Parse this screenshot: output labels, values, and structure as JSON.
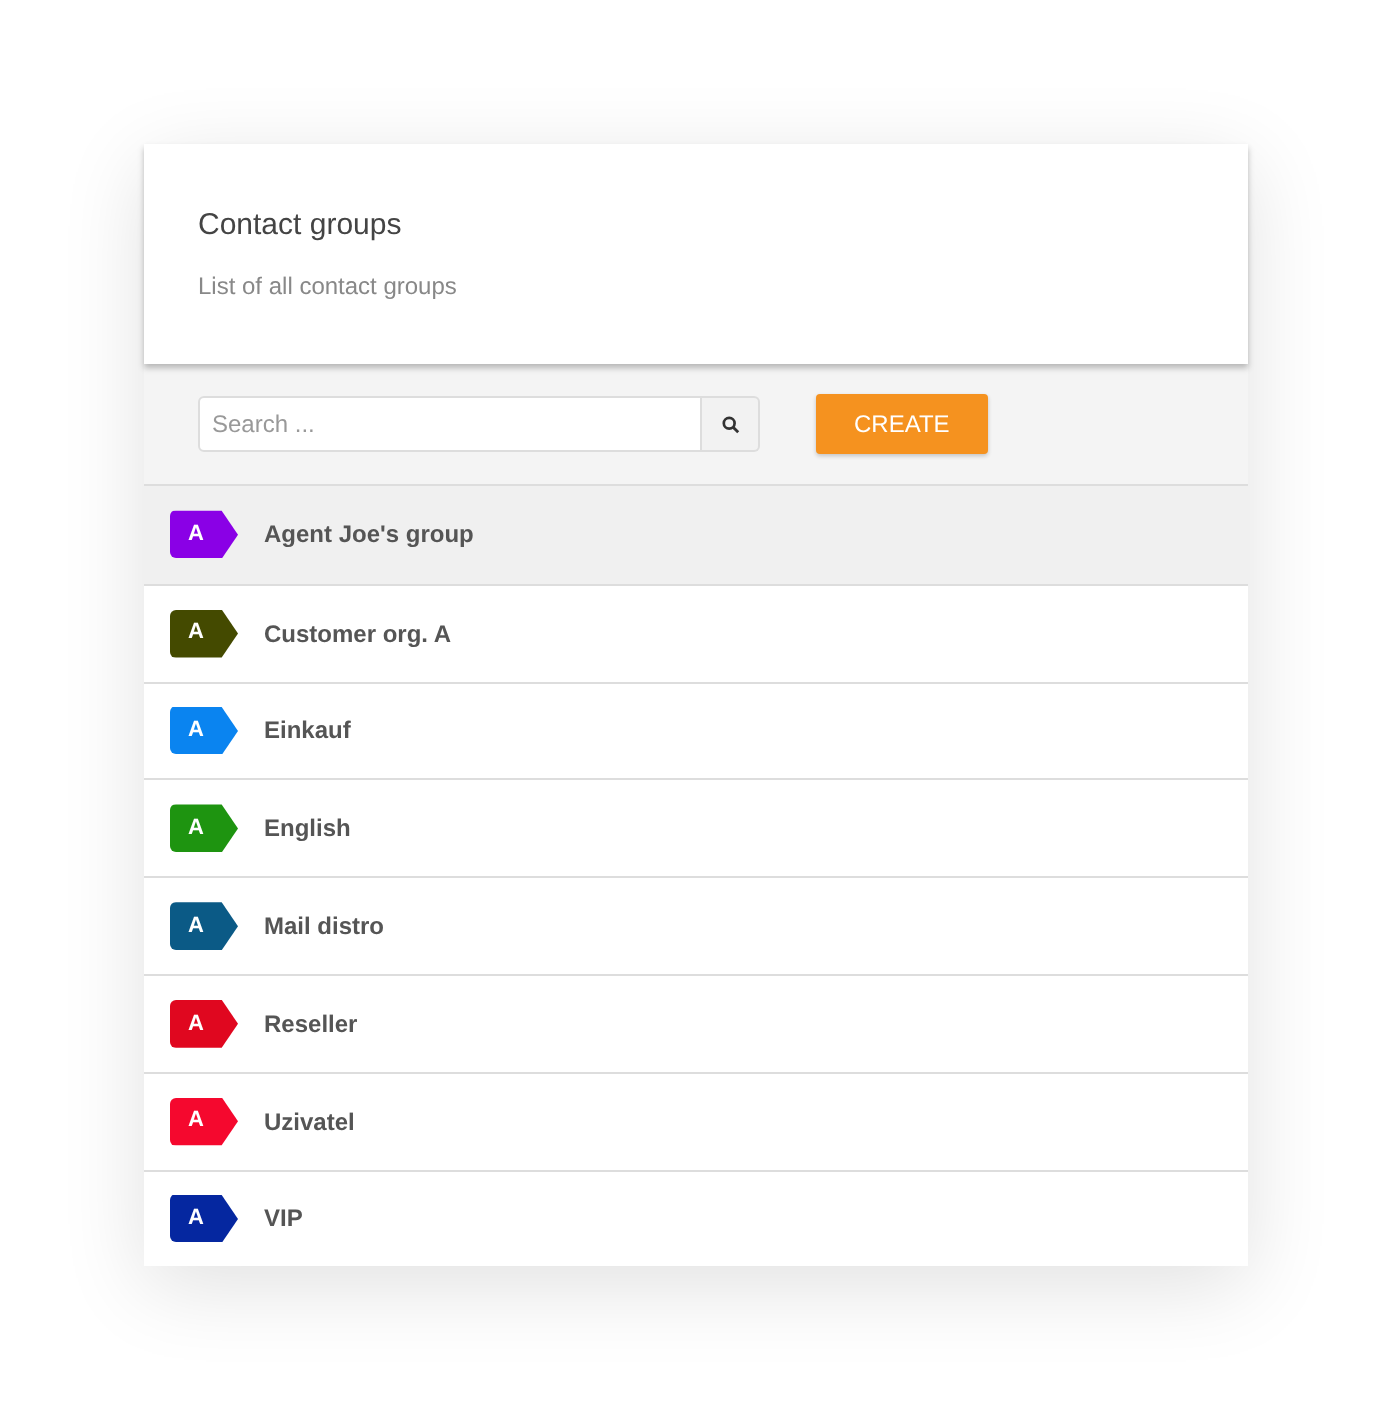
{
  "header": {
    "title": "Contact groups",
    "subtitle": "List of all contact groups"
  },
  "toolbar": {
    "search": {
      "placeholder": "Search ..."
    },
    "create_button": "CREATE"
  },
  "groups": [
    {
      "name": "Agent Joe's group",
      "tag": "A",
      "color": "#8a00e6",
      "selected": true
    },
    {
      "name": "Customer org. A",
      "tag": "A",
      "color": "#444a00",
      "selected": false
    },
    {
      "name": "Einkauf",
      "tag": "A",
      "color": "#0a84f0",
      "selected": false
    },
    {
      "name": "English",
      "tag": "A",
      "color": "#1e9410",
      "selected": false
    },
    {
      "name": "Mail distro",
      "tag": "A",
      "color": "#0b5a86",
      "selected": false
    },
    {
      "name": "Reseller",
      "tag": "A",
      "color": "#e0071f",
      "selected": false
    },
    {
      "name": "Uzivatel",
      "tag": "A",
      "color": "#f5082e",
      "selected": false
    },
    {
      "name": "VIP",
      "tag": "A",
      "color": "#0527a0",
      "selected": false
    }
  ]
}
